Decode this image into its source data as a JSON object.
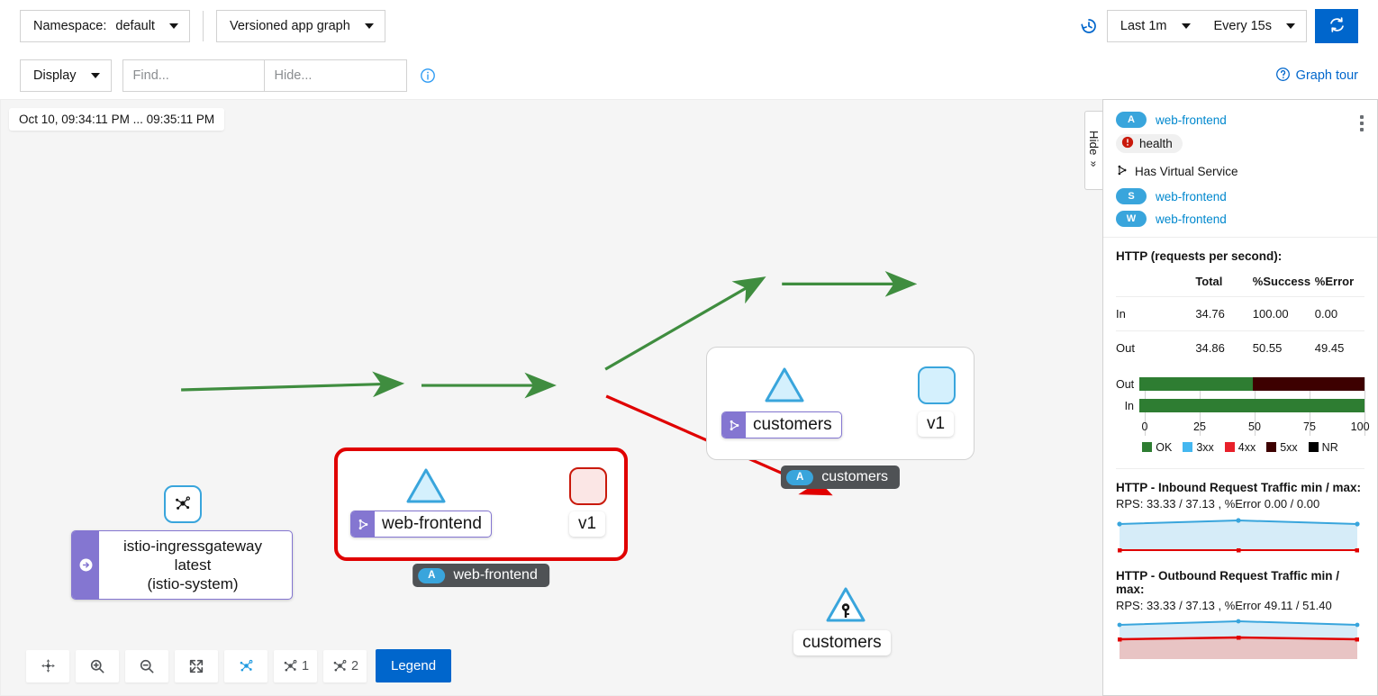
{
  "toolbar": {
    "namespace_label": "Namespace:",
    "namespace_value": "default",
    "graph_type": "Versioned app graph",
    "display_label": "Display",
    "find_placeholder": "Find...",
    "hide_placeholder": "Hide...",
    "find_value": "",
    "hide_value": "",
    "info_icon": "info-circle-icon",
    "history_icon": "history-icon",
    "time_range": "Last 1m",
    "refresh_interval": "Every 15s",
    "refresh_icon": "sync-icon",
    "graph_tour": "Graph tour",
    "graph_tour_icon": "help-circle-icon",
    "accent": "#0066cc"
  },
  "graph": {
    "timestamp": "Oct 10, 09:34:11 PM ... 09:35:11 PM",
    "hide_tab_label": "Hide",
    "hide_tab_chevron": "»",
    "nodes": {
      "ingressgateway": {
        "label_line1": "istio-ingressgateway",
        "label_line2": "latest",
        "label_line3": "(istio-system)",
        "icon": "mesh-node-icon",
        "badge_icon": "gateway-arrow-icon"
      },
      "web_frontend_group": {
        "app_label": "web-frontend",
        "version_label": "v1",
        "badge_kind": "A",
        "badge_label": "web-frontend",
        "vs_icon": "virtual-service-icon",
        "selected": true,
        "version_status": "error"
      },
      "customers_group": {
        "app_label": "customers",
        "version_label": "v1",
        "badge_kind": "A",
        "badge_label": "customers",
        "vs_icon": "virtual-service-icon",
        "selected": false,
        "version_status": "ok"
      },
      "customers_service": {
        "label": "customers",
        "icon": "key-icon"
      }
    },
    "edge_colors": {
      "ok": "#3f8d3f",
      "error": "#e00000"
    },
    "tools": [
      {
        "name": "reset-view-button",
        "icon": "arrows-move-icon",
        "label": ""
      },
      {
        "name": "zoom-in-button",
        "icon": "zoom-in-icon",
        "label": ""
      },
      {
        "name": "zoom-out-button",
        "icon": "zoom-out-icon",
        "label": ""
      },
      {
        "name": "fit-to-screen-button",
        "icon": "expand-icon",
        "label": ""
      },
      {
        "name": "graph-layout-default-button",
        "icon": "topology-icon",
        "label": ""
      },
      {
        "name": "graph-layout-1-button",
        "icon": "topology-icon",
        "label": "1"
      },
      {
        "name": "graph-layout-2-button",
        "icon": "topology-icon",
        "label": "2"
      }
    ],
    "legend_button": "Legend"
  },
  "side_panel": {
    "kind_badge": "A",
    "title": "web-frontend",
    "health_label": "health",
    "health_icon": "error-circle-icon",
    "kebab_icon": "kebab-menu-icon",
    "virtual_service_text": "Has Virtual Service",
    "virtual_service_icon": "virtual-service-icon",
    "links": [
      {
        "kind": "S",
        "label": "web-frontend"
      },
      {
        "kind": "W",
        "label": "web-frontend"
      }
    ],
    "http_title": "HTTP (requests per second):",
    "table": {
      "headers": [
        "",
        "Total",
        "%Success",
        "%Error"
      ],
      "rows": [
        {
          "dir": "In",
          "total": "34.76",
          "success": "100.00",
          "error": "0.00"
        },
        {
          "dir": "Out",
          "total": "34.86",
          "success": "50.55",
          "error": "49.45"
        }
      ]
    },
    "sparklines": [
      {
        "title": "HTTP - Inbound Request Traffic min / max:",
        "subtitle": "RPS: 33.33 / 37.13 , %Error 0.00 / 0.00"
      },
      {
        "title": "HTTP - Outbound Request Traffic min / max:",
        "subtitle": "RPS: 33.33 / 37.13 , %Error 49.11 / 51.40"
      }
    ]
  },
  "chart_data": [
    {
      "type": "bar",
      "orientation": "horizontal",
      "stacked": true,
      "title": "HTTP (requests per second)",
      "categories": [
        "Out",
        "In"
      ],
      "series": [
        {
          "name": "OK",
          "color": "#2e7d32",
          "values": [
            50.55,
            100.0
          ]
        },
        {
          "name": "3xx",
          "color": "#44b7f0",
          "values": [
            0,
            0
          ]
        },
        {
          "name": "4xx",
          "color": "#e8202a",
          "values": [
            0,
            0
          ]
        },
        {
          "name": "5xx",
          "color": "#3d0000",
          "values": [
            49.45,
            0
          ]
        },
        {
          "name": "NR",
          "color": "#000000",
          "values": [
            0,
            0
          ]
        }
      ],
      "xlabel": "",
      "ylabel": "",
      "xlim": [
        0,
        100
      ],
      "xticks": [
        0,
        25,
        50,
        75,
        100
      ],
      "grid": true,
      "legend": [
        "OK",
        "3xx",
        "4xx",
        "5xx",
        "NR"
      ],
      "legend_position": "bottom"
    },
    {
      "type": "area",
      "title": "HTTP - Inbound Request Traffic min / max:",
      "subtitle": "RPS: 33.33 / 37.13 , %Error 0.00 / 0.00",
      "x": [
        0,
        0.5,
        1
      ],
      "series": [
        {
          "name": "RPS",
          "color": "#39a5dc",
          "values": [
            33.33,
            37.13,
            35.6
          ]
        },
        {
          "name": "%Error",
          "color": "#e00000",
          "values": [
            0.0,
            0.0,
            0.0
          ]
        }
      ],
      "grid": false,
      "legend_position": "none"
    },
    {
      "type": "area",
      "title": "HTTP - Outbound Request Traffic min / max:",
      "subtitle": "RPS: 33.33 / 37.13 , %Error 49.11 / 51.40",
      "x": [
        0,
        0.5,
        1
      ],
      "series": [
        {
          "name": "RPS",
          "color": "#39a5dc",
          "values": [
            33.33,
            37.13,
            35.6
          ]
        },
        {
          "name": "%Error",
          "color": "#e00000",
          "values": [
            49.11,
            51.4,
            50.6
          ]
        }
      ],
      "grid": false,
      "legend_position": "none"
    }
  ]
}
